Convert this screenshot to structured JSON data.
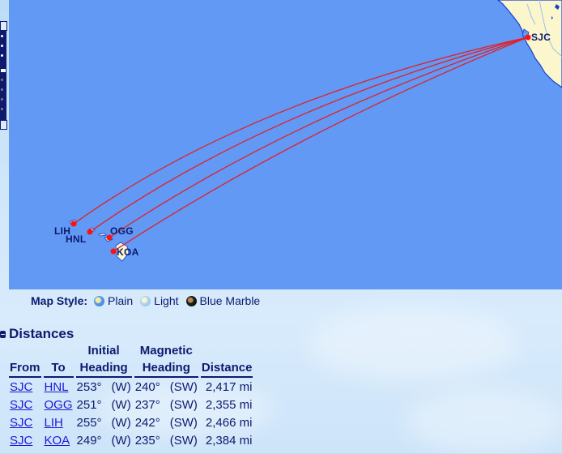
{
  "map": {
    "routes_from": "SJC",
    "airports": [
      {
        "code": "SJC"
      },
      {
        "code": "LIH"
      },
      {
        "code": "HNL"
      },
      {
        "code": "OGG"
      },
      {
        "code": "KOA"
      }
    ],
    "colors": {
      "ocean": "#6199f4",
      "land": "#fbf6cc",
      "route": "#e0202a",
      "airport_dot": "#ff1010",
      "label": "#0d1a6e"
    }
  },
  "map_style": {
    "label": "Map Style:",
    "options": [
      {
        "name": "Plain",
        "icon": "globe-plain-icon"
      },
      {
        "name": "Light",
        "icon": "globe-light-icon"
      },
      {
        "name": "Blue Marble",
        "icon": "globe-bluemarble-icon"
      }
    ]
  },
  "distances": {
    "title": "Distances",
    "headers": {
      "from": "From",
      "to": "To",
      "initial_top": "Initial",
      "initial_bottom": "Heading",
      "magnetic_top": "Magnetic",
      "magnetic_bottom": "Heading",
      "distance": "Distance"
    },
    "rows": [
      {
        "from": "SJC",
        "to": "HNL",
        "initial": "253°",
        "initial_dir": "(W)",
        "magnetic": "240°",
        "magnetic_dir": "(SW)",
        "distance": "2,417 mi"
      },
      {
        "from": "SJC",
        "to": "OGG",
        "initial": "251°",
        "initial_dir": "(W)",
        "magnetic": "237°",
        "magnetic_dir": "(SW)",
        "distance": "2,355 mi"
      },
      {
        "from": "SJC",
        "to": "LIH",
        "initial": "255°",
        "initial_dir": "(W)",
        "magnetic": "242°",
        "magnetic_dir": "(SW)",
        "distance": "2,466 mi"
      },
      {
        "from": "SJC",
        "to": "KOA",
        "initial": "249°",
        "initial_dir": "(W)",
        "magnetic": "235°",
        "magnetic_dir": "(SW)",
        "distance": "2,384 mi"
      }
    ]
  }
}
